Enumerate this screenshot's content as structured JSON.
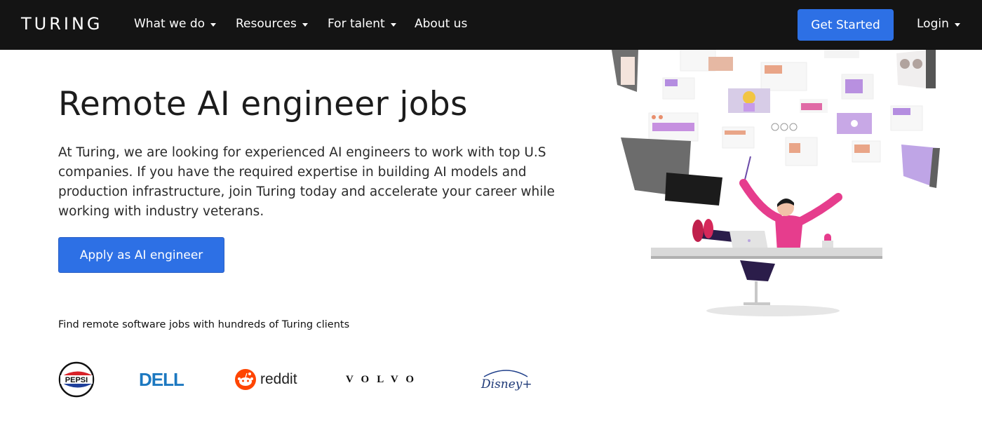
{
  "brand": "TURING",
  "nav": {
    "items": [
      {
        "label": "What we do",
        "dropdown": true
      },
      {
        "label": "Resources",
        "dropdown": true
      },
      {
        "label": "For talent",
        "dropdown": true
      },
      {
        "label": "About us",
        "dropdown": false
      }
    ],
    "get_started": "Get Started",
    "login": "Login"
  },
  "hero": {
    "title": "Remote AI engineer jobs",
    "description": "At Turing, we are looking for experienced AI engineers to work with top U.S companies. If you have the required expertise in building AI models and production infrastructure, join Turing today and accelerate your career while working with industry veterans.",
    "cta": "Apply as AI engineer"
  },
  "clients": {
    "title": "Find remote software jobs with hundreds of Turing clients",
    "logos": [
      "PEPSI",
      "DELL",
      "reddit",
      "VOLVO",
      "Disney+"
    ]
  },
  "colors": {
    "nav_bg": "#141414",
    "accent": "#2d70e5",
    "text": "#1c1c1c"
  }
}
